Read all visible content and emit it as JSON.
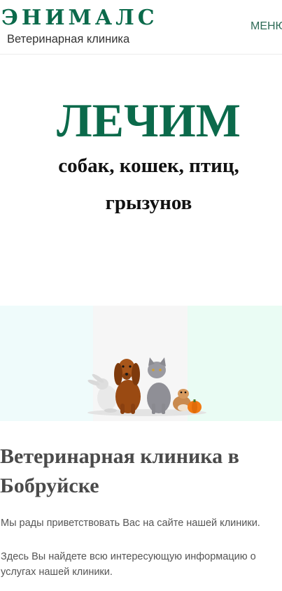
{
  "header": {
    "logo_title": "ЭНИМАЛС",
    "logo_subtitle": "Ветеринарная клиника",
    "menu_label": "МЕНЮ"
  },
  "hero": {
    "headline": "ЛЕЧИМ",
    "line1": "собак, кошек, птиц,",
    "line2": "грызунов"
  },
  "banner": {
    "image_alt": "rabbit-dog-cat-hamster-photo"
  },
  "content": {
    "title": "Ветеринарная клиника в Бобруйске",
    "paragraph1": "Мы рады приветствовать Вас на сайте нашей клиники.",
    "paragraph2_line1": "Здесь Вы найдете всю интересующую информацию о",
    "paragraph2_line2": "услугах нашей клиники."
  },
  "colors": {
    "brand_green": "#0b6a4b",
    "banner_left": "#effbfb",
    "banner_right": "#eafcf4"
  }
}
